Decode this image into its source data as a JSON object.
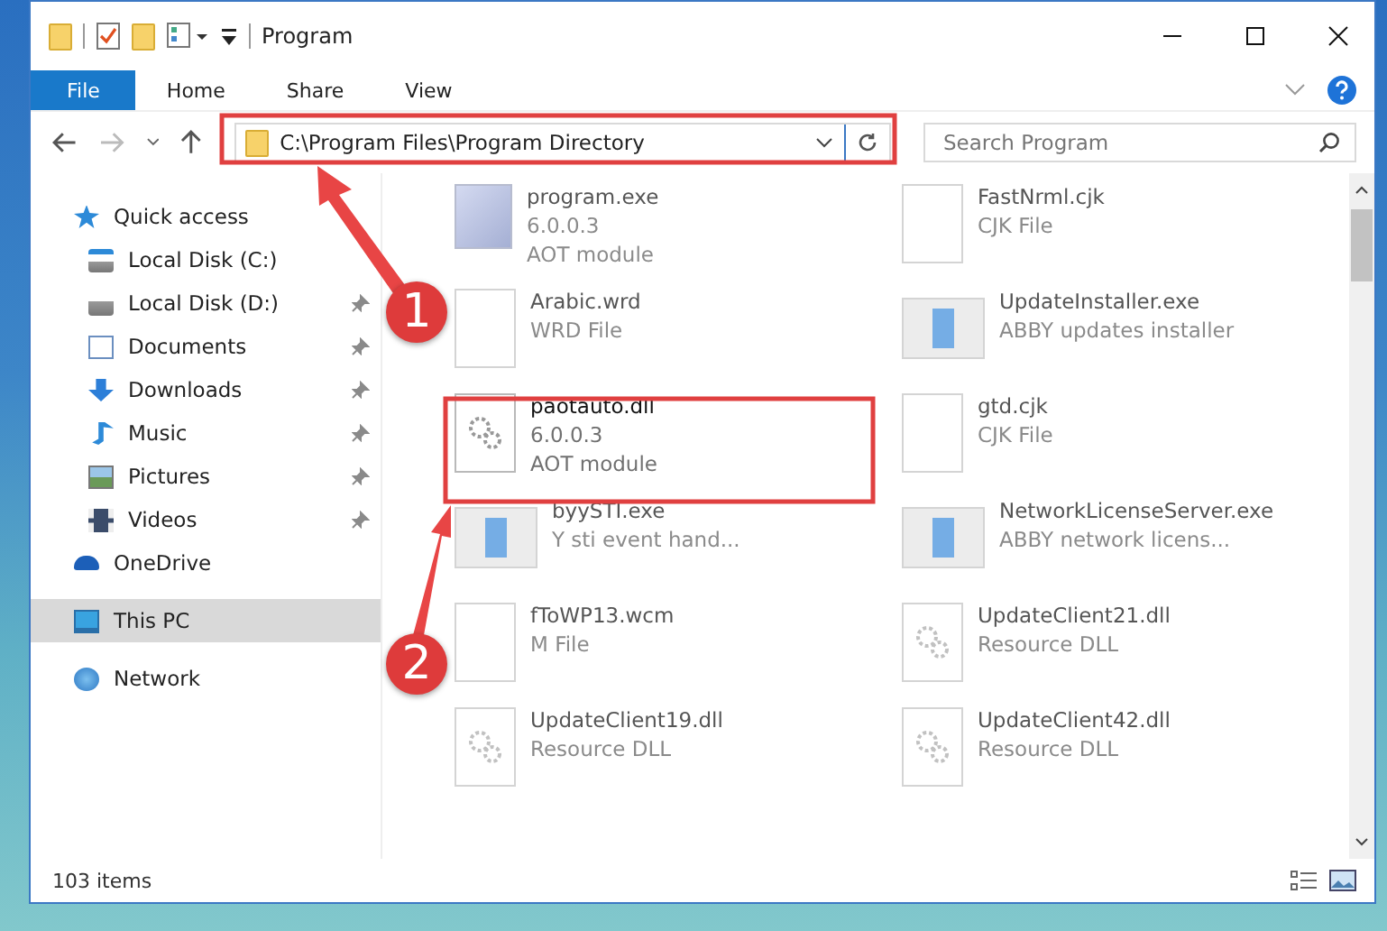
{
  "window": {
    "title": "Program"
  },
  "ribbon_tabs": [
    {
      "label": "File",
      "selected": true
    },
    {
      "label": "Home",
      "selected": false
    },
    {
      "label": "Share",
      "selected": false
    },
    {
      "label": "View",
      "selected": false
    }
  ],
  "address_bar": {
    "path": "C:\\Program Files\\Program Directory"
  },
  "search": {
    "placeholder": "Search Program"
  },
  "sidebar": {
    "items": [
      {
        "label": "Quick access",
        "kind": "star",
        "selected": false,
        "children": [
          {
            "label": "Local Disk (C:)",
            "kind": "drive-c",
            "pinned": false,
            "selected": false
          },
          {
            "label": "Local Disk (D:)",
            "kind": "drive",
            "pinned": true,
            "selected": false
          },
          {
            "label": "Documents",
            "kind": "documents",
            "pinned": true,
            "selected": false
          },
          {
            "label": "Downloads",
            "kind": "downloads",
            "pinned": true,
            "selected": false
          },
          {
            "label": "Music",
            "kind": "music",
            "pinned": true,
            "selected": false
          },
          {
            "label": "Pictures",
            "kind": "pictures",
            "pinned": true,
            "selected": false
          },
          {
            "label": "Videos",
            "kind": "videos",
            "pinned": true,
            "selected": false
          }
        ]
      },
      {
        "label": "OneDrive",
        "kind": "cloud",
        "selected": false
      },
      {
        "label": "This PC",
        "kind": "pc",
        "selected": true
      },
      {
        "label": "Network",
        "kind": "network",
        "selected": false
      }
    ]
  },
  "files": [
    {
      "name": "program.exe",
      "lines": [
        "6.0.0.3",
        "AOT module"
      ],
      "kind": "program",
      "blurred": true
    },
    {
      "name": "FastNrml.cjk",
      "lines": [
        "CJK File"
      ],
      "kind": "blank",
      "blurred": true
    },
    {
      "name": "Arabic.wrd",
      "lines": [
        "WRD File"
      ],
      "kind": "blank",
      "blurred": true
    },
    {
      "name": "UpdateInstaller.exe",
      "lines": [
        "ABBY updates installer"
      ],
      "kind": "app",
      "blurred": true
    },
    {
      "name": "paotauto.dll",
      "lines": [
        "6.0.0.3",
        "AOT module"
      ],
      "kind": "gear",
      "blurred": false
    },
    {
      "name": "gtd.cjk",
      "lines": [
        "CJK File"
      ],
      "kind": "blank",
      "blurred": true
    },
    {
      "name": "byySTI.exe",
      "lines": [
        "Y sti event hand..."
      ],
      "kind": "app",
      "blurred": true
    },
    {
      "name": "NetworkLicenseServer.exe",
      "lines": [
        "ABBY network licens..."
      ],
      "kind": "app",
      "blurred": true
    },
    {
      "name": "fToWP13.wcm",
      "lines": [
        "M File"
      ],
      "kind": "blank",
      "blurred": true
    },
    {
      "name": "UpdateClient21.dll",
      "lines": [
        "Resource DLL"
      ],
      "kind": "gear",
      "blurred": true
    },
    {
      "name": "UpdateClient19.dll",
      "lines": [
        "Resource DLL"
      ],
      "kind": "gear",
      "blurred": true
    },
    {
      "name": "UpdateClient42.dll",
      "lines": [
        "Resource DLL"
      ],
      "kind": "gear",
      "blurred": true
    }
  ],
  "status_bar": {
    "count": "103 items"
  },
  "callouts": [
    "1",
    "2"
  ]
}
